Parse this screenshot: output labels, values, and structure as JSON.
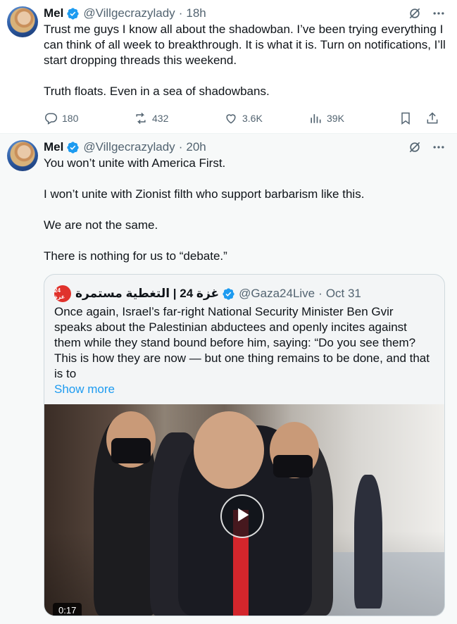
{
  "tweets": [
    {
      "name": "Mel",
      "handle": "@Villgecrazylady",
      "separator": "·",
      "time": "18h",
      "paragraphs": [
        "Trust me guys I know all about the shadowban. I’ve been trying everything I can think of all week to breakthrough. It is what it is. Turn on notifications, I’ll start dropping threads this weekend.",
        "Truth floats. Even in a sea of shadowbans."
      ],
      "stats": {
        "replies": "180",
        "reposts": "432",
        "likes": "3.6K",
        "views": "39K"
      }
    },
    {
      "name": "Mel",
      "handle": "@Villgecrazylady",
      "separator": "·",
      "time": "20h",
      "paragraphs": [
        "You won’t unite with America First.",
        "I won’t unite with Zionist filth who support barbarism like this.",
        "We are not the same.",
        "There is nothing for us to “debate.”"
      ],
      "quote": {
        "avatar_text": "24 غزة",
        "name": "غزة 24 | التغطية مستمرة",
        "handle": "@Gaza24Live",
        "separator": "·",
        "time": "Oct 31",
        "text": "Once again, Israel’s far-right National Security Minister Ben Gvir speaks about the Palestinian abductees and openly incites against them while they stand bound before him, saying: “Do you see them? This is how they are now — but one thing remains to be done, and that is to",
        "show_more": "Show more",
        "video_duration": "0:17"
      }
    }
  ],
  "icons": {
    "verified": "verified-badge-icon",
    "grok": "grok-icon",
    "more": "more-icon",
    "reply": "reply-icon",
    "repost": "repost-icon",
    "like": "heart-icon",
    "views": "views-icon",
    "bookmark": "bookmark-icon",
    "share": "share-icon",
    "play": "play-icon"
  },
  "colors": {
    "accent": "#1d9bf0",
    "verified": "#1d9bf0",
    "muted": "#536471"
  }
}
